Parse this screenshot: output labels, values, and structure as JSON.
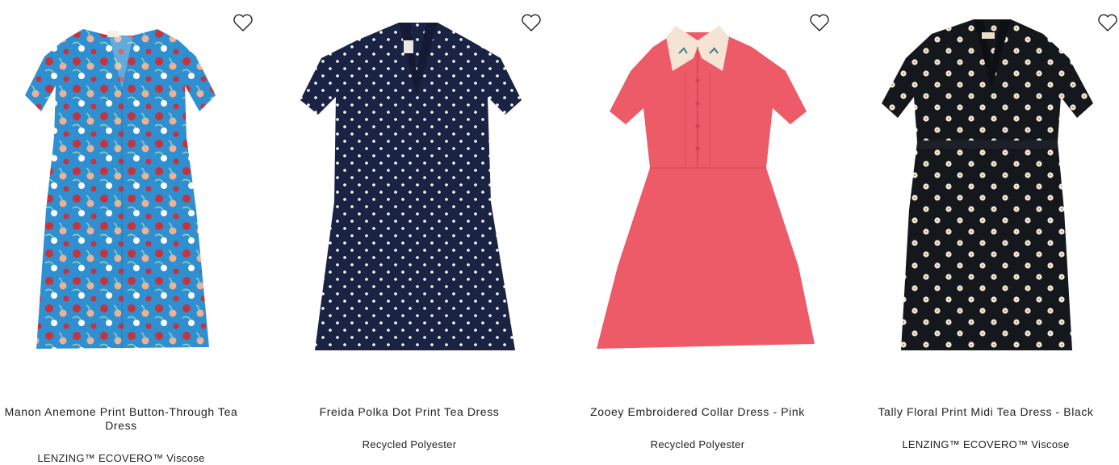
{
  "products": [
    {
      "name": "Manon Anemone Print Button-Through Tea Dress",
      "material": "LENZING™ ECOVERO™ Viscose",
      "image_icon": "dress-blue-floral-image",
      "colors": {
        "base": "#2f8fd0",
        "print1": "#c8323b",
        "print2": "#f0b091",
        "print3": "#ffffff"
      }
    },
    {
      "name": "Freida Polka Dot Print Tea Dress",
      "material": "Recycled Polyester",
      "image_icon": "dress-navy-polka-dot-image",
      "colors": {
        "base": "#1b2344",
        "print1": "#ffffff"
      }
    },
    {
      "name": "Zooey Embroidered Collar Dress - Pink",
      "material": "Recycled Polyester",
      "image_icon": "dress-pink-collar-image",
      "colors": {
        "base": "#ec5b67",
        "collar": "#f5e3d3"
      }
    },
    {
      "name": "Tally Floral Print Midi Tea Dress - Black",
      "material": "LENZING™ ECOVERO™ Viscose",
      "image_icon": "dress-black-floral-image",
      "colors": {
        "base": "#14171c",
        "print1": "#f2e8d6"
      }
    }
  ],
  "wishlist_icon": "heart-outline-icon"
}
